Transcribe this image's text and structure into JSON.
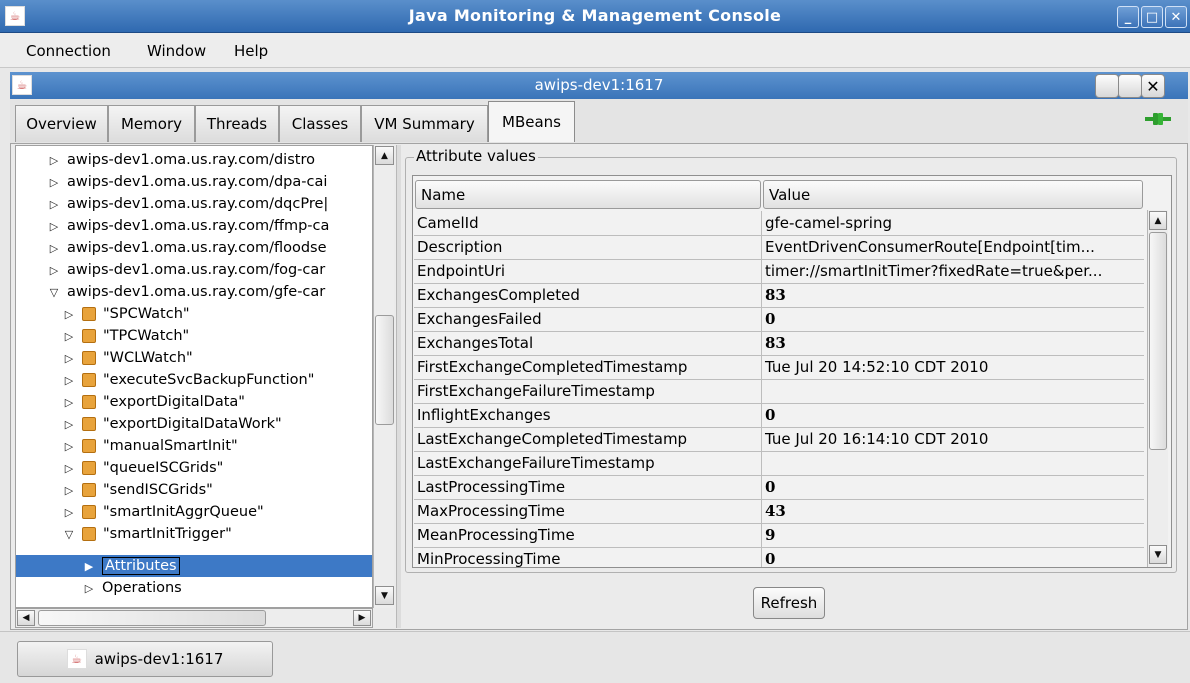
{
  "window": {
    "title": "Java Monitoring & Management Console",
    "min_glyph": "_",
    "max_glyph": "□",
    "close_glyph": "✕"
  },
  "menubar": {
    "items": [
      {
        "label": "Connection"
      },
      {
        "label": "Window"
      },
      {
        "label": "Help"
      }
    ]
  },
  "inner_frame": {
    "title": "awips-dev1:1617",
    "close_glyph": "✕"
  },
  "tabs": [
    {
      "label": "Overview"
    },
    {
      "label": "Memory"
    },
    {
      "label": "Threads"
    },
    {
      "label": "Classes"
    },
    {
      "label": "VM Summary"
    },
    {
      "label": "MBeans",
      "selected": true
    }
  ],
  "tree": {
    "items": [
      {
        "label": "awips-dev1.oma.us.ray.com/distro",
        "arrow": "▷"
      },
      {
        "label": "awips-dev1.oma.us.ray.com/dpa-cai",
        "arrow": "▷"
      },
      {
        "label": "awips-dev1.oma.us.ray.com/dqcPre|",
        "arrow": "▷"
      },
      {
        "label": "awips-dev1.oma.us.ray.com/ffmp-ca",
        "arrow": "▷"
      },
      {
        "label": "awips-dev1.oma.us.ray.com/floodse",
        "arrow": "▷"
      },
      {
        "label": "awips-dev1.oma.us.ray.com/fog-car",
        "arrow": "▷"
      },
      {
        "label": "awips-dev1.oma.us.ray.com/gfe-car",
        "arrow": "▽"
      },
      {
        "label": "\"SPCWatch\"",
        "arrow": "▷"
      },
      {
        "label": "\"TPCWatch\"",
        "arrow": "▷"
      },
      {
        "label": "\"WCLWatch\"",
        "arrow": "▷"
      },
      {
        "label": "\"executeSvcBackupFunction\"",
        "arrow": "▷"
      },
      {
        "label": "\"exportDigitalData\"",
        "arrow": "▷"
      },
      {
        "label": "\"exportDigitalDataWork\"",
        "arrow": "▷"
      },
      {
        "label": "\"manualSmartInit\"",
        "arrow": "▷"
      },
      {
        "label": "\"queueISCGrids\"",
        "arrow": "▷"
      },
      {
        "label": "\"sendISCGrids\"",
        "arrow": "▷"
      },
      {
        "label": "\"smartInitAggrQueue\"",
        "arrow": "▷"
      },
      {
        "label": "\"smartInitTrigger\"",
        "arrow": "▽"
      },
      {
        "label": "Attributes",
        "arrow": "▶",
        "selected": true
      },
      {
        "label": "Operations",
        "arrow": "▷"
      }
    ],
    "scroll_up": "▲",
    "scroll_down": "▼",
    "scroll_left": "◀",
    "scroll_right": "▶"
  },
  "attributes": {
    "group_title": "Attribute values",
    "columns": [
      "Name",
      "Value"
    ],
    "rows": [
      {
        "name": "CamelId",
        "value": "gfe-camel-spring"
      },
      {
        "name": "Description",
        "value": "EventDrivenConsumerRoute[Endpoint[tim..."
      },
      {
        "name": "EndpointUri",
        "value": "timer://smartInitTimer?fixedRate=true&per..."
      },
      {
        "name": "ExchangesCompleted",
        "value": "83"
      },
      {
        "name": "ExchangesFailed",
        "value": "0"
      },
      {
        "name": "ExchangesTotal",
        "value": "83"
      },
      {
        "name": "FirstExchangeCompletedTimestamp",
        "value": "Tue Jul 20 14:52:10 CDT 2010"
      },
      {
        "name": "FirstExchangeFailureTimestamp",
        "value": ""
      },
      {
        "name": "InflightExchanges",
        "value": "0"
      },
      {
        "name": "LastExchangeCompletedTimestamp",
        "value": "Tue Jul 20 16:14:10 CDT 2010"
      },
      {
        "name": "LastExchangeFailureTimestamp",
        "value": ""
      },
      {
        "name": "LastProcessingTime",
        "value": "0"
      },
      {
        "name": "MaxProcessingTime",
        "value": "43"
      },
      {
        "name": "MeanProcessingTime",
        "value": "9"
      },
      {
        "name": "MinProcessingTime",
        "value": "0"
      }
    ],
    "refresh_label": "Refresh"
  },
  "taskbar": {
    "item_label": "awips-dev1:1617"
  },
  "colors": {
    "titlebar": "#3a74b9",
    "selection": "#3d79c6",
    "connected": "#2e9e2e"
  },
  "icons": [
    "java-icon",
    "connection-plug-icon",
    "mbean-icon"
  ]
}
